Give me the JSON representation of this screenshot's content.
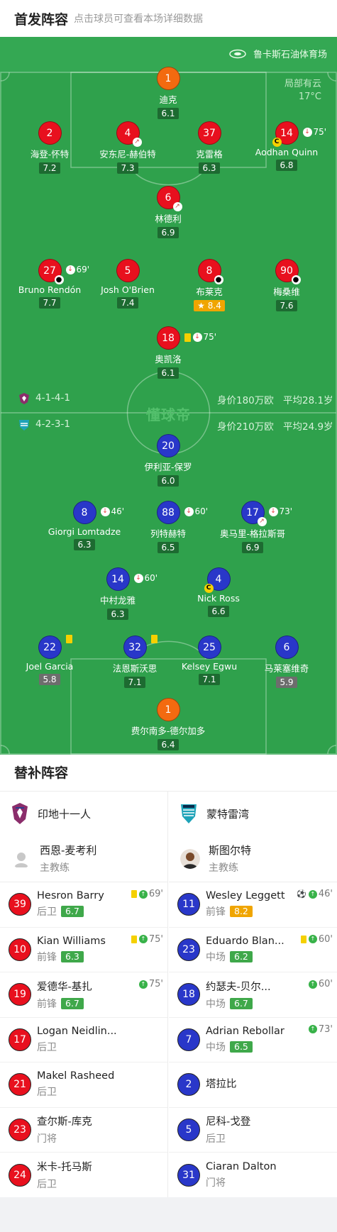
{
  "header": {
    "title": "首发阵容",
    "subtitle": "点击球员可查看本场详细数据"
  },
  "stadium": {
    "name": "鲁卡斯石油体育场",
    "icon": "stadium-icon"
  },
  "weather": {
    "condition": "局部有云",
    "temp": "17°C"
  },
  "watermark": "懂球帝",
  "home_info": {
    "formation": "4-1-4-1",
    "value": "身价180万欧",
    "age": "平均28.1岁"
  },
  "away_info": {
    "formation": "4-2-3-1",
    "value": "身价210万欧",
    "age": "平均24.9岁"
  },
  "home_players": [
    {
      "num": "1",
      "name": "迪克",
      "rating": "6.1",
      "gk": true
    },
    {
      "num": "2",
      "name": "海登-怀特",
      "rating": "7.2"
    },
    {
      "num": "4",
      "name": "安东尼-赫伯特",
      "rating": "7.3",
      "arrow": true
    },
    {
      "num": "37",
      "name": "克雷格",
      "rating": "6.3"
    },
    {
      "num": "14",
      "name": "Aodhan Quinn",
      "rating": "6.8",
      "sub_out": "75'",
      "captain": true
    },
    {
      "num": "6",
      "name": "林德利",
      "rating": "6.9",
      "arrow": true
    },
    {
      "num": "27",
      "name": "Bruno Rendón",
      "rating": "7.7",
      "sub_out": "69'",
      "goal": true
    },
    {
      "num": "5",
      "name": "Josh O'Brien",
      "rating": "7.4"
    },
    {
      "num": "8",
      "name": "布莱克",
      "rating": "8.4",
      "goal": true,
      "star": true
    },
    {
      "num": "90",
      "name": "梅桑维",
      "rating": "7.6",
      "goal": true
    },
    {
      "num": "18",
      "name": "奥凯洛",
      "rating": "6.1",
      "sub_out": "75'",
      "yellow": true
    }
  ],
  "away_players": [
    {
      "num": "20",
      "name": "伊利亚-保罗",
      "rating": "6.0"
    },
    {
      "num": "8",
      "name": "Giorgi Lomtadze",
      "rating": "6.3",
      "sub_out": "46'"
    },
    {
      "num": "88",
      "name": "列特赫特",
      "rating": "6.5",
      "sub_out": "60'"
    },
    {
      "num": "17",
      "name": "奥马里-格拉斯哥",
      "rating": "6.9",
      "sub_out": "73'",
      "arrow": true
    },
    {
      "num": "14",
      "name": "中村龙雅",
      "rating": "6.3",
      "sub_out": "60'"
    },
    {
      "num": "4",
      "name": "Nick Ross",
      "rating": "6.6",
      "captain": true
    },
    {
      "num": "22",
      "name": "Joel Garcia",
      "rating": "5.8",
      "yellow": true,
      "grey": true
    },
    {
      "num": "32",
      "name": "法恩斯沃思",
      "rating": "7.1",
      "yellow": true
    },
    {
      "num": "25",
      "name": "Kelsey Egwu",
      "rating": "7.1"
    },
    {
      "num": "6",
      "name": "马莱塞维奇",
      "rating": "5.9",
      "grey": true
    },
    {
      "num": "1",
      "name": "费尔南多-德尔加多",
      "rating": "6.4",
      "gk": true
    }
  ],
  "subs": {
    "title": "替补阵容",
    "home": {
      "team": "印地十一人",
      "coach": {
        "name": "西恩-麦考利",
        "role": "主教练"
      },
      "players": [
        {
          "num": "39",
          "name": "Hesron Barry",
          "pos": "后卫",
          "rating": "6.7",
          "yellow": true,
          "in": "69'"
        },
        {
          "num": "10",
          "name": "Kian Williams",
          "pos": "前锋",
          "rating": "6.3",
          "yellow": true,
          "in": "75'"
        },
        {
          "num": "19",
          "name": "爱德华-基扎",
          "pos": "前锋",
          "rating": "6.7",
          "in": "75'"
        },
        {
          "num": "17",
          "name": "Logan Neidlin...",
          "pos": "后卫"
        },
        {
          "num": "21",
          "name": "Makel Rasheed",
          "pos": "后卫"
        },
        {
          "num": "23",
          "name": "查尔斯-库克",
          "pos": "门将"
        },
        {
          "num": "24",
          "name": "米卡-托马斯",
          "pos": "后卫"
        }
      ]
    },
    "away": {
      "team": "蒙特雷湾",
      "coach": {
        "name": "斯图尔特",
        "role": "主教练"
      },
      "players": [
        {
          "num": "11",
          "name": "Wesley Leggett",
          "pos": "前锋",
          "rating": "8.2",
          "gold": true,
          "goal": true,
          "in": "46'"
        },
        {
          "num": "23",
          "name": "Eduardo Blan...",
          "pos": "中场",
          "rating": "6.2",
          "yellow": true,
          "in": "60'"
        },
        {
          "num": "18",
          "name": "约瑟夫-贝尔...",
          "pos": "中场",
          "rating": "6.7",
          "in": "60'"
        },
        {
          "num": "7",
          "name": "Adrian Rebollar",
          "pos": "中场",
          "rating": "6.5",
          "in": "73'"
        },
        {
          "num": "2",
          "name": "塔拉比",
          "pos": ""
        },
        {
          "num": "5",
          "name": "尼科-戈登",
          "pos": "后卫"
        },
        {
          "num": "31",
          "name": "Ciaran Dalton",
          "pos": "门将"
        }
      ]
    }
  },
  "colors": {
    "pitch": "#2fa14c",
    "home": "#e8101e",
    "away": "#2937c9",
    "gk": "#f36a10",
    "rating_bg": "#1d6b31",
    "gold": "#f0a500"
  }
}
